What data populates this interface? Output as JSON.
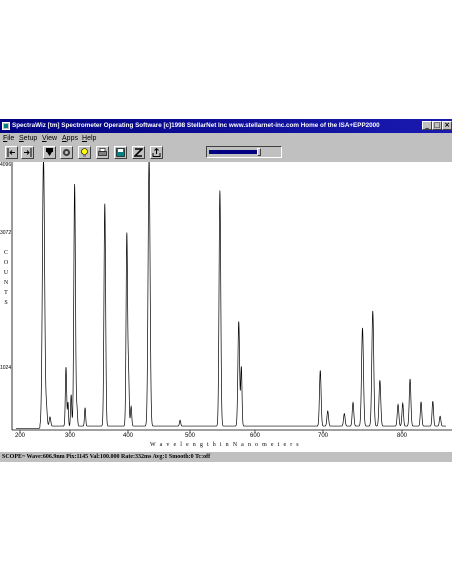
{
  "window": {
    "title": "SpectraWiz [tm] Spectrometer Operating Software   [c]1998 StellarNet Inc  www.stellarnet-inc.com  Home of the ISA+EPP2000",
    "controls": {
      "minimize": "_",
      "maximize": "□",
      "close": "×"
    }
  },
  "menu": {
    "items": [
      "File",
      "Setup",
      "View",
      "Apps",
      "Help"
    ]
  },
  "toolbar": {
    "buttons": [
      "left-marker-icon",
      "right-marker-icon",
      "download-icon",
      "record-icon",
      "lightbulb-icon",
      "printer-icon",
      "disk-icon",
      "zoom-z-icon",
      "export-icon"
    ],
    "slider_level": 0.68
  },
  "plot": {
    "ylabel_letters": [
      "C",
      "O",
      "U",
      "N",
      "T",
      "S"
    ],
    "xlabel": "W a v e l e n g t h  i n  N a n o m e t e r s",
    "ytick_labels": [
      "4096",
      "3072",
      "1024"
    ],
    "xtick_labels": [
      "200",
      "300",
      "400",
      "500",
      "600",
      "700",
      "800"
    ]
  },
  "chart_data": {
    "type": "line",
    "xlabel": "Wavelength in Nanometers",
    "ylabel": "COUNTS",
    "xlim": [
      185,
      860
    ],
    "ylim": [
      0,
      4096
    ],
    "grid": false,
    "baseline": 60,
    "peaks": [
      {
        "x": 247,
        "y": 4096,
        "w": 2.2
      },
      {
        "x": 253,
        "y": 260,
        "w": 1.5
      },
      {
        "x": 260,
        "y": 140,
        "w": 1.5
      },
      {
        "x": 292,
        "y": 900,
        "w": 1.3
      },
      {
        "x": 296,
        "y": 360,
        "w": 1.0
      },
      {
        "x": 302,
        "y": 480,
        "w": 1.0
      },
      {
        "x": 308,
        "y": 3700,
        "w": 1.4
      },
      {
        "x": 312,
        "y": 260,
        "w": 1.0
      },
      {
        "x": 326,
        "y": 280,
        "w": 1.0
      },
      {
        "x": 360,
        "y": 3400,
        "w": 1.4
      },
      {
        "x": 398,
        "y": 2950,
        "w": 1.3
      },
      {
        "x": 401,
        "y": 700,
        "w": 1.0
      },
      {
        "x": 405,
        "y": 300,
        "w": 1.0
      },
      {
        "x": 434,
        "y": 4096,
        "w": 1.6
      },
      {
        "x": 484,
        "y": 90,
        "w": 1.0
      },
      {
        "x": 546,
        "y": 3600,
        "w": 1.3
      },
      {
        "x": 575,
        "y": 1600,
        "w": 1.3
      },
      {
        "x": 579,
        "y": 900,
        "w": 1.0
      },
      {
        "x": 696,
        "y": 850,
        "w": 1.2
      },
      {
        "x": 706,
        "y": 230,
        "w": 1.0
      },
      {
        "x": 727,
        "y": 190,
        "w": 1.0
      },
      {
        "x": 738,
        "y": 360,
        "w": 1.0
      },
      {
        "x": 750,
        "y": 1500,
        "w": 1.2
      },
      {
        "x": 763,
        "y": 1760,
        "w": 1.2
      },
      {
        "x": 772,
        "y": 700,
        "w": 1.1
      },
      {
        "x": 795,
        "y": 330,
        "w": 1.0
      },
      {
        "x": 801,
        "y": 350,
        "w": 1.0
      },
      {
        "x": 811,
        "y": 720,
        "w": 1.1
      },
      {
        "x": 826,
        "y": 370,
        "w": 1.0
      },
      {
        "x": 842,
        "y": 380,
        "w": 1.0
      },
      {
        "x": 852,
        "y": 150,
        "w": 1.0
      }
    ]
  },
  "status": {
    "text": "SCOPE~  Wave:606.9nm  Pix:1145  Val:100.000  Rate:332ms  Avg:1  Smooth:0  Tc:off"
  }
}
